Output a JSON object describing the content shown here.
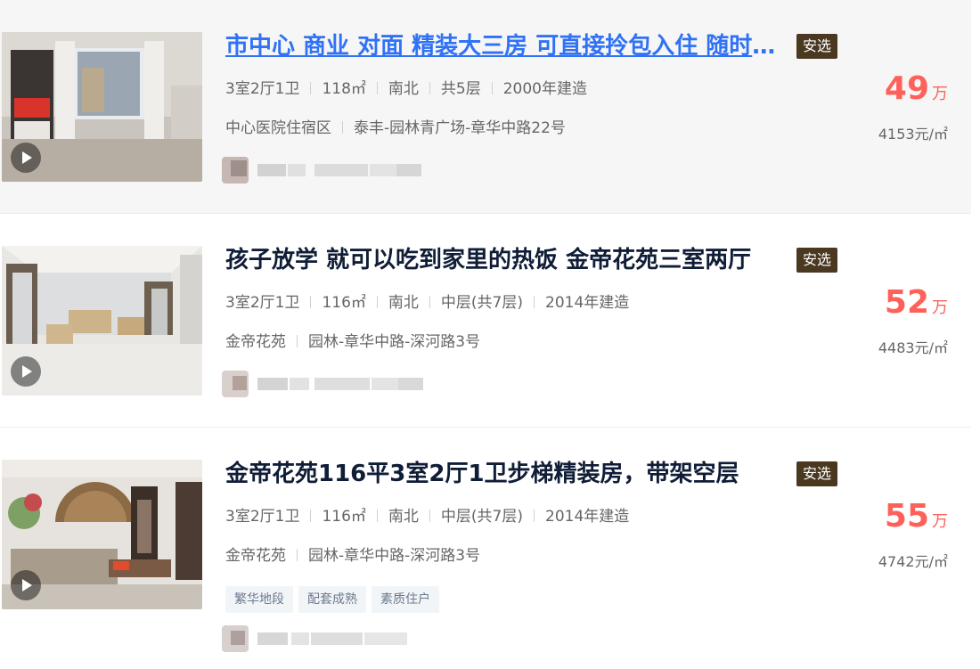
{
  "listings": [
    {
      "title": "市中心 商业 对面 精装大三房 可直接拎包入住 随时看房",
      "badge": "安选",
      "layout": "3室2厅1卫",
      "area": "118㎡",
      "orientation": "南北",
      "floor": "共5层",
      "built": "2000年建造",
      "community": "中心医院住宿区",
      "location": "泰丰-园林青广场-章华中路22号",
      "price_value": "49",
      "price_unit": "万",
      "unit_price": "4153元/㎡",
      "tags": []
    },
    {
      "title": "孩子放学 就可以吃到家里的热饭 金帝花苑三室两厅",
      "badge": "安选",
      "layout": "3室2厅1卫",
      "area": "116㎡",
      "orientation": "南北",
      "floor": "中层(共7层)",
      "built": "2014年建造",
      "community": "金帝花苑",
      "location": "园林-章华中路-深河路3号",
      "price_value": "52",
      "price_unit": "万",
      "unit_price": "4483元/㎡",
      "tags": []
    },
    {
      "title": "金帝花苑116平3室2厅1卫步梯精装房，带架空层",
      "badge": "安选",
      "layout": "3室2厅1卫",
      "area": "116㎡",
      "orientation": "南北",
      "floor": "中层(共7层)",
      "built": "2014年建造",
      "community": "金帝花苑",
      "location": "园林-章华中路-深河路3号",
      "price_value": "55",
      "price_unit": "万",
      "unit_price": "4742元/㎡",
      "tags": [
        "繁华地段",
        "配套成熟",
        "素质住户"
      ]
    }
  ],
  "icons": {
    "play": "play-icon"
  },
  "colors": {
    "price": "#fe615a",
    "badge_bg": "#4a3821",
    "title_hover": "#3072f6",
    "title": "#101d37"
  }
}
